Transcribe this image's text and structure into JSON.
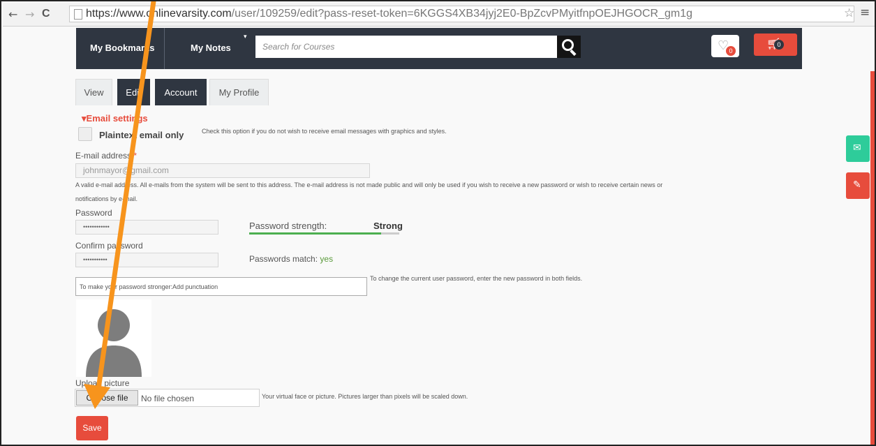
{
  "browser": {
    "back": "←",
    "forward": "→",
    "reload": "C",
    "url_host": "https://www.onlinevarsity.com",
    "url_path": "/user/109259/edit?pass-reset-token=6KGGS4XB34jyj2E0-BpZcvPMyitfnpOEJHGOCR_gm1g",
    "star": "☆",
    "menu": "≡"
  },
  "header": {
    "bookmarks": "My Bookmarks",
    "notes": "My Notes",
    "caret": "▾",
    "search_placeholder": "Search for Courses",
    "wishlist_count": "0",
    "cart_count": "0"
  },
  "tabs": [
    {
      "label": "View"
    },
    {
      "label": "Edit"
    },
    {
      "label": "Account"
    },
    {
      "label": "My Profile"
    }
  ],
  "email_settings": {
    "title": "▾Email settings",
    "plaintext_label": "Plaintext email only",
    "plaintext_help": "Check this option if you do not wish to receive email messages with graphics and styles."
  },
  "email": {
    "label": "E-mail address",
    "required": "*",
    "value": "johnmayor@gmail.com",
    "help_line1": "A valid e-mail address. All e-mails from the system will be sent to this address. The e-mail address is not made public and will only be used if you wish to receive a new password or wish to receive certain news or",
    "help_line2": "notifications by e-mail."
  },
  "password": {
    "label": "Password",
    "value": "••••••••••••",
    "strength_label": "Password strength:",
    "strength_value": "Strong",
    "strength_fraction": 0.88,
    "confirm_label": "Confirm password",
    "confirm_value": "•••••••••••",
    "match_label": "Passwords match:",
    "match_value": "yes",
    "hint": "To make your password stronger:Add punctuation",
    "change_help": "To change the current user password, enter the new password in both fields."
  },
  "picture": {
    "upload_label": "Upload picture",
    "choose_button": "Choose file",
    "no_file": "No file chosen",
    "help": "Your virtual face or picture. Pictures larger than pixels will be scaled down."
  },
  "save_label": "Save",
  "colors": {
    "accent": "#e74c3c",
    "header_bg": "#2f3641",
    "mail_btn": "#2ecc9a",
    "edit_btn": "#e74c3c",
    "annotation": "#f7941d"
  }
}
